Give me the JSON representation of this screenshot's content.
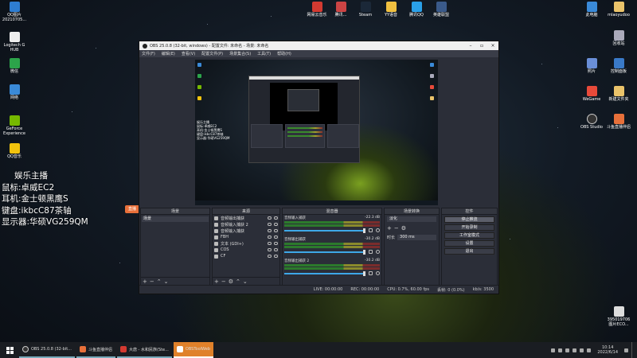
{
  "desktop": {
    "left_icons": [
      {
        "label": "QQ图片\n20210705...",
        "color": "#2e7dd1"
      },
      {
        "label": "Logitech G\nHUB",
        "color": "#eee"
      },
      {
        "label": "微信",
        "color": "#2ca44a"
      },
      {
        "label": "网络",
        "color": "#3a8ad8"
      },
      {
        "label": "GeForce\nExperience",
        "color": "#76b900"
      },
      {
        "label": "QQ音乐",
        "color": "#f2c30d"
      }
    ],
    "top_icons": [
      {
        "label": "网易云音乐",
        "color": "#d33a31"
      },
      {
        "label": "腾讯...",
        "color": "#cc4444"
      },
      {
        "label": "Steam",
        "color": "#1b2838"
      },
      {
        "label": "YY语音",
        "color": "#f0c040"
      },
      {
        "label": "腾讯QQ",
        "color": "#2aa0e8"
      },
      {
        "label": "英雄联盟",
        "color": "#3a5a8a"
      }
    ],
    "right_icons": [
      {
        "label": "此电脑",
        "color": "#3a8ad8"
      },
      {
        "label": "mlaoyudoo",
        "color": "#eac36a"
      },
      {
        "label": "回收站",
        "color": "#aab"
      },
      {
        "label": "照片",
        "color": "#6a8fd8"
      },
      {
        "label": "控制面板",
        "color": "#3a7ac8"
      },
      {
        "label": "WeGame",
        "color": "#e84a3a"
      },
      {
        "label": "新建文件夹",
        "color": "#eac36a"
      },
      {
        "label": "OBS Studio",
        "color": "#333"
      },
      {
        "label": "斗鱼直播伴侣",
        "color": "#e8703a"
      },
      {
        "label": "395019706\n图片ECO...",
        "color": "#ddd"
      }
    ],
    "overlay_lines": [
      "娱乐主播",
      "鼠标:卓威EC2",
      "耳机:金士顿黑鹰S",
      "键盘:ikbcC87茶轴",
      "显示器:华硕VG259QM"
    ]
  },
  "obs": {
    "title": "OBS 25.0.8 (32-bit, windows) - 配置文件: 未命名 - 场景: 未命名",
    "menu": [
      "文件(F)",
      "编辑(E)",
      "查看(V)",
      "配置文件(P)",
      "场景集合(S)",
      "工具(T)",
      "帮助(H)"
    ],
    "side_tag": "直播",
    "preview_text": [
      "娱乐主播",
      "鼠标:卓威EC2",
      "耳机:金士顿黑鹰S",
      "键盘:ikbcC87茶轴",
      "显示器:华硕VG259QM"
    ],
    "panels": {
      "scenes": {
        "header": "场景",
        "items": [
          "场景"
        ]
      },
      "sources": {
        "header": "来源",
        "items": [
          "音频输出捕获",
          "音频输入捕获 2",
          "音频输入捕获",
          "FBH",
          "文本 (GDI+)",
          "COS",
          "CF"
        ]
      },
      "mixer": {
        "header": "混音器",
        "tracks": [
          {
            "name": "音频输入捕获",
            "db": "-22.3 dB"
          },
          {
            "name": "音频输出捕获",
            "db": "-30.2 dB"
          },
          {
            "name": "音频输出捕获 2",
            "db": "-30.2 dB"
          }
        ]
      },
      "transitions": {
        "header": "场景转换",
        "type": "淡化",
        "duration_label": "时长",
        "duration": "300 ms"
      },
      "controls": {
        "header": "控件",
        "buttons": [
          "停止推流",
          "开始录制",
          "工作室模式",
          "设置",
          "退出"
        ]
      }
    },
    "status": {
      "live": "LIVE: 00:00:00",
      "rec": "REC: 00:00:00",
      "cpu": "CPU: 0.7%, 60.00 fps",
      "dropped": "丢帧: 0 (0.0%)",
      "kbps": "kb/s: 3500"
    }
  },
  "taskbar": {
    "items": [
      {
        "label": "OBS 25.0.8 (32-bit...",
        "color": "#333"
      },
      {
        "label": "斗鱼直播伴侣",
        "color": "#e8703a"
      },
      {
        "label": "大唐 - 水和民族(Ste...",
        "color": "#d33a31"
      },
      {
        "label": "OBSToolWeb",
        "color": "#e8703a"
      }
    ],
    "time": "10:14",
    "date": "2022/6/14"
  }
}
